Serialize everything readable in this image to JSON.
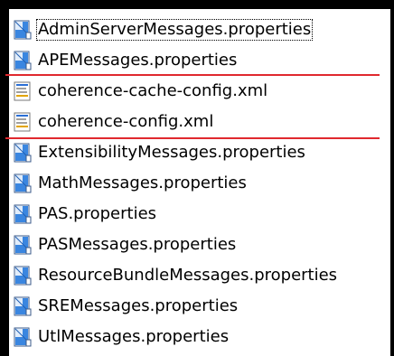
{
  "files": [
    {
      "name": "AdminServerMessages.properties",
      "type": "properties",
      "focused": true
    },
    {
      "name": "APEMessages.properties",
      "type": "properties"
    },
    {
      "name": "coherence-cache-config.xml",
      "type": "xml"
    },
    {
      "name": "coherence-config.xml",
      "type": "xml"
    },
    {
      "name": "ExtensibilityMessages.properties",
      "type": "properties"
    },
    {
      "name": "MathMessages.properties",
      "type": "properties"
    },
    {
      "name": "PAS.properties",
      "type": "properties"
    },
    {
      "name": "PASMessages.properties",
      "type": "properties"
    },
    {
      "name": "ResourceBundleMessages.properties",
      "type": "properties"
    },
    {
      "name": "SREMessages.properties",
      "type": "properties"
    },
    {
      "name": "UtlMessages.properties",
      "type": "properties"
    }
  ],
  "colors": {
    "highlight": "#e0292e",
    "properties_icon": "#3a86e0",
    "xml_icon": "#ffffff"
  },
  "icons": {
    "properties": "properties-file-icon",
    "xml": "xml-file-icon"
  }
}
